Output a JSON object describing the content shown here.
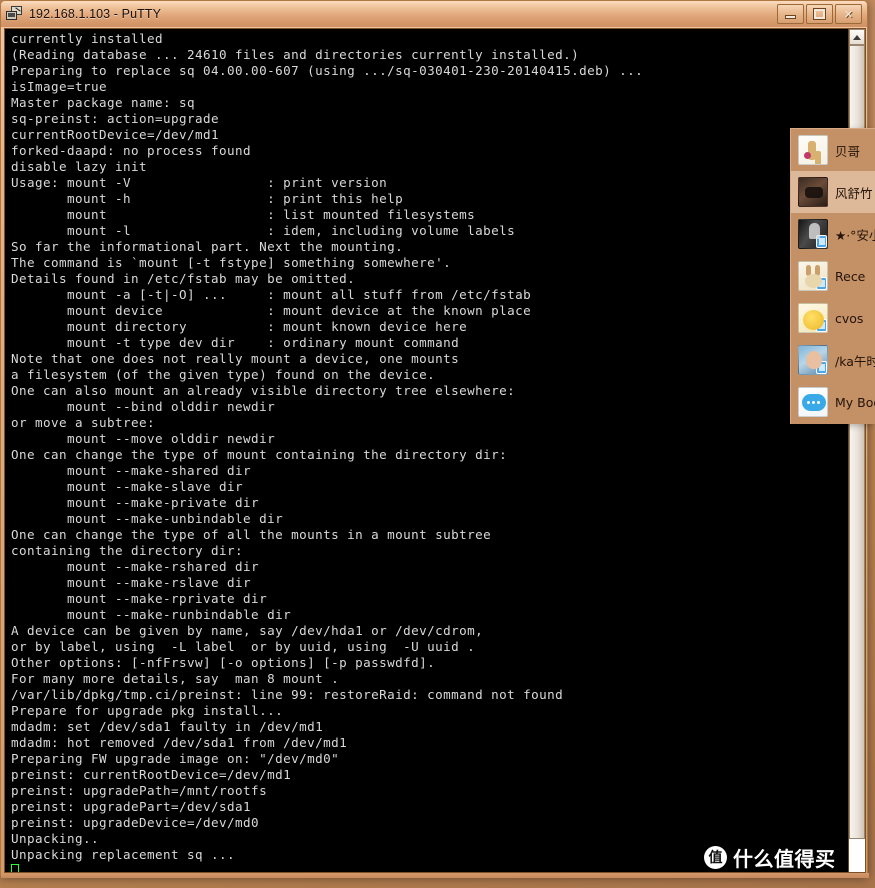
{
  "window": {
    "title": "192.168.1.103 - PuTTY",
    "app_icon": "putty-terminal-icon",
    "buttons": {
      "minimize": "minimize",
      "maximize": "restore",
      "close": "✕"
    }
  },
  "terminal": {
    "lines": [
      "currently installed",
      "(Reading database ... 24610 files and directories currently installed.)",
      "Preparing to replace sq 04.00.00-607 (using .../sq-030401-230-20140415.deb) ...",
      "isImage=true",
      "Master package name: sq",
      "sq-preinst: action=upgrade",
      "currentRootDevice=/dev/md1",
      "forked-daapd: no process found",
      "disable lazy init",
      "Usage: mount -V                 : print version",
      "       mount -h                 : print this help",
      "       mount                    : list mounted filesystems",
      "       mount -l                 : idem, including volume labels",
      "So far the informational part. Next the mounting.",
      "The command is `mount [-t fstype] something somewhere'.",
      "Details found in /etc/fstab may be omitted.",
      "       mount -a [-t|-O] ...     : mount all stuff from /etc/fstab",
      "       mount device             : mount device at the known place",
      "       mount directory          : mount known device here",
      "       mount -t type dev dir    : ordinary mount command",
      "Note that one does not really mount a device, one mounts",
      "a filesystem (of the given type) found on the device.",
      "One can also mount an already visible directory tree elsewhere:",
      "       mount --bind olddir newdir",
      "or move a subtree:",
      "       mount --move olddir newdir",
      "One can change the type of mount containing the directory dir:",
      "       mount --make-shared dir",
      "       mount --make-slave dir",
      "       mount --make-private dir",
      "       mount --make-unbindable dir",
      "One can change the type of all the mounts in a mount subtree",
      "containing the directory dir:",
      "       mount --make-rshared dir",
      "       mount --make-rslave dir",
      "       mount --make-rprivate dir",
      "       mount --make-runbindable dir",
      "A device can be given by name, say /dev/hda1 or /dev/cdrom,",
      "or by label, using  -L label  or by uuid, using  -U uuid .",
      "Other options: [-nfFrsvw] [-o options] [-p passwdfd].",
      "For many more details, say  man 8 mount .",
      "/var/lib/dpkg/tmp.ci/preinst: line 99: restoreRaid: command not found",
      "Prepare for upgrade pkg install...",
      "mdadm: set /dev/sda1 faulty in /dev/md1",
      "mdadm: hot removed /dev/sda1 from /dev/md1",
      "Preparing FW upgrade image on: \"/dev/md0\"",
      "preinst: currentRootDevice=/dev/md1",
      "preinst: upgradePath=/mnt/rootfs",
      "preinst: upgradePart=/dev/sda1",
      "preinst: upgradeDevice=/dev/md0",
      "Unpacking..",
      "Unpacking replacement sq ..."
    ],
    "colors": {
      "background": "#000000",
      "foreground": "#d9d9d9",
      "cursor": "#2aff2a"
    }
  },
  "scrollbar": {
    "up_arrow": "scroll-up",
    "down_arrow": "scroll-down"
  },
  "contact_panel": {
    "items": [
      {
        "name": "贝哥",
        "avatar": "av-giraffe",
        "mobile": false,
        "selected": false
      },
      {
        "name": "风舒竹",
        "avatar": "av-dark",
        "mobile": false,
        "selected": true
      },
      {
        "name": "★·°安小",
        "avatar": "av-bw",
        "mobile": true,
        "selected": false
      },
      {
        "name": "Rece",
        "avatar": "av-rabbit",
        "mobile": true,
        "selected": false
      },
      {
        "name": "cvos",
        "avatar": "av-chick",
        "mobile": true,
        "selected": false
      },
      {
        "name": "/ka午时",
        "avatar": "av-girl",
        "mobile": true,
        "selected": false
      },
      {
        "name": "My Bool",
        "avatar": "av-chat",
        "mobile": false,
        "selected": false
      }
    ]
  },
  "watermark": {
    "logo_char": "值",
    "text": "什么值得买"
  }
}
